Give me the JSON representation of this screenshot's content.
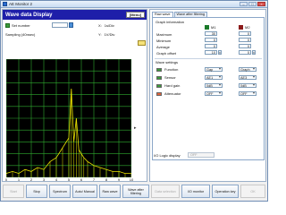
{
  "window": {
    "title": "AE Monitor 2"
  },
  "left": {
    "header": "Wave data Display",
    "menu_label": "[Menu]",
    "set_number_label": "Set number",
    "sampling_label": "Sampling (40nsec)",
    "x_label": "X:",
    "x_value": "1s/Div",
    "y_label": "Y:",
    "y_value": "1V/Div",
    "x_ticks": [
      "0",
      "1",
      "2",
      "3",
      "4",
      "5",
      "6",
      "7",
      "8",
      "9",
      "10"
    ]
  },
  "chart_data": {
    "type": "line",
    "x": [
      0,
      0.5,
      1,
      1.5,
      2,
      2.5,
      3,
      3.5,
      4,
      4.5,
      5,
      5.2,
      5.4,
      5.6,
      5.8,
      6,
      6.2,
      6.5,
      7,
      7.5,
      8,
      8.5,
      9,
      9.5,
      10
    ],
    "series": [
      {
        "values": [
          0.2,
          0.3,
          0.2,
          0.4,
          0.3,
          0.5,
          0.4,
          0.8,
          1.0,
          1.5,
          2.0,
          4.5,
          1.8,
          3.0,
          1.4,
          1.2,
          1.0,
          0.8,
          0.6,
          0.5,
          0.4,
          0.3,
          0.3,
          0.2,
          0.2
        ]
      }
    ],
    "xlim": [
      0,
      10
    ],
    "ylim": [
      0,
      6
    ],
    "grid": true,
    "colors": {
      "line": "#e8e000",
      "grid": "#2faa2f",
      "background": "#000000"
    }
  },
  "right": {
    "tabs": [
      "Raw wave",
      "Wave after filtering"
    ],
    "graph_info_label": "Graph information",
    "ch1": "M1",
    "ch2": "M2",
    "rows": [
      {
        "label": "Maximum",
        "v1": "30",
        "v2": "0"
      },
      {
        "label": "Minimum",
        "v1": "0",
        "v2": "0"
      },
      {
        "label": "Average",
        "v1": "0",
        "v2": "0"
      },
      {
        "label": "Graph offset",
        "v1": "10",
        "v2": "0"
      }
    ],
    "wave_settings_label": "Wave settings",
    "wave_rows": [
      {
        "label": "Function",
        "v1": "Gap",
        "v2": "Graph"
      },
      {
        "label": "Sensor",
        "v1": "AE1",
        "v2": "AE3"
      },
      {
        "label": "Hard gain",
        "v1": "0dB",
        "v2": "0dB"
      },
      {
        "label": "Attenuator",
        "v1": "OFF",
        "v2": "OFF"
      }
    ],
    "io_label": "I/O Logic display",
    "io_value": "OFF"
  },
  "toolbar": {
    "buttons": [
      {
        "label": "Start",
        "disabled": true
      },
      {
        "label": "Stop",
        "disabled": false
      },
      {
        "label": "Spectrum",
        "disabled": false
      },
      {
        "label": "Auto/ Manual",
        "disabled": false
      },
      {
        "label": "Raw wave",
        "disabled": false
      },
      {
        "label": "Wave after filtering",
        "disabled": false
      },
      {
        "label": "Data selection",
        "disabled": true
      },
      {
        "label": "I/O monitor",
        "disabled": false
      },
      {
        "label": "Operation key",
        "disabled": false
      },
      {
        "label": "OK",
        "disabled": true
      }
    ]
  }
}
